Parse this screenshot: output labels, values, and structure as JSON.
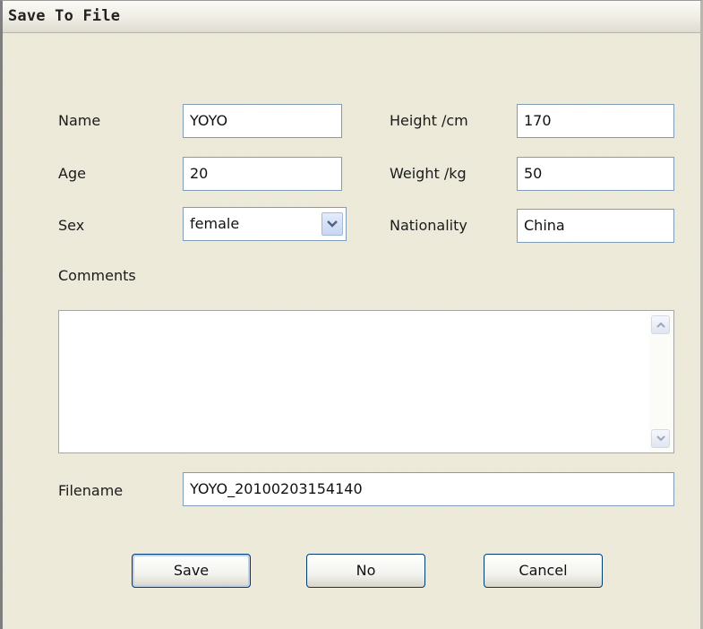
{
  "window": {
    "title": "Save To File"
  },
  "form": {
    "name": {
      "label": "Name",
      "value": "YOYO"
    },
    "age": {
      "label": "Age",
      "value": "20"
    },
    "sex": {
      "label": "Sex",
      "value": "female"
    },
    "height": {
      "label": "Height /cm",
      "value": "170"
    },
    "weight": {
      "label": "Weight /kg",
      "value": "50"
    },
    "nationality": {
      "label": "Nationality",
      "value": "China"
    },
    "comments": {
      "label": "Comments",
      "value": ""
    },
    "filename": {
      "label": "Filename",
      "value": "YOYO_20100203154140"
    }
  },
  "buttons": {
    "save": "Save",
    "no": "No",
    "cancel": "Cancel"
  },
  "icons": {
    "dropdown": "chevron-down-icon",
    "scroll_up": "arrow-up-icon",
    "scroll_down": "arrow-down-icon"
  },
  "colors": {
    "dialog_background": "#ece9d8",
    "field_border": "#7f9db9",
    "button_border": "#003c74"
  }
}
